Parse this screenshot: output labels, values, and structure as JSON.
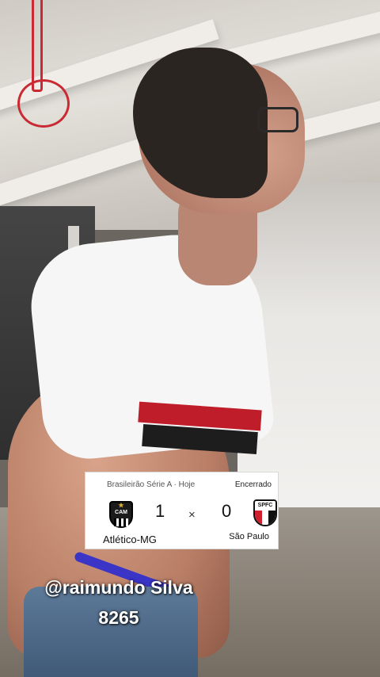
{
  "scoreboard": {
    "league": "Brasileirão Série A · Hoje",
    "status": "Encerrado",
    "home": {
      "name": "Atlético-MG",
      "score": "1",
      "crest_text": "CAM",
      "crest_icon": "atletico-mg-crest-icon"
    },
    "separator": "×",
    "away": {
      "name": "São Paulo",
      "score": "0",
      "crest_text": "SPFC",
      "crest_icon": "sao-paulo-crest-icon"
    }
  },
  "caption": {
    "line1": "@raimundo Silva",
    "line2": "8265"
  },
  "colors": {
    "card_background": "#ffffff",
    "caption_text": "#ffffff",
    "away_red": "#d0202e",
    "home_black": "#1b1b1b"
  }
}
